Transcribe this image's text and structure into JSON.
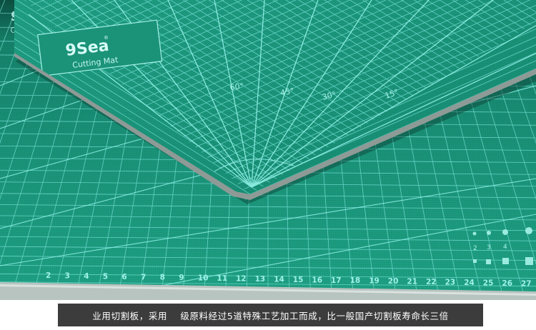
{
  "brand": {
    "logo_text": "9Sea",
    "logo_mark": "®",
    "subtitle": "Cutting Mat"
  },
  "angle_labels": [
    "60°",
    "45°",
    "30°",
    "15°"
  ],
  "ruler_numbers": [
    "2",
    "3",
    "4",
    "5",
    "6",
    "7",
    "8",
    "9",
    "10",
    "11",
    "12",
    "13",
    "14",
    "15",
    "16",
    "17",
    "18",
    "19",
    "20",
    "21",
    "22",
    "23",
    "24",
    "25",
    "26",
    "27"
  ],
  "corner_marks": [
    "2",
    "3",
    "4"
  ],
  "caption": "业用切割板，采用    级原料经过5道特殊工艺加工而成，比一般国产切割板寿命长三倍",
  "colors": {
    "mat_green": "#1d9a7f",
    "grid_line": "#7fe7de",
    "edge_gray": "#8e9a96",
    "caption_bg": "#3c3c3c",
    "caption_text": "#ffffff"
  }
}
